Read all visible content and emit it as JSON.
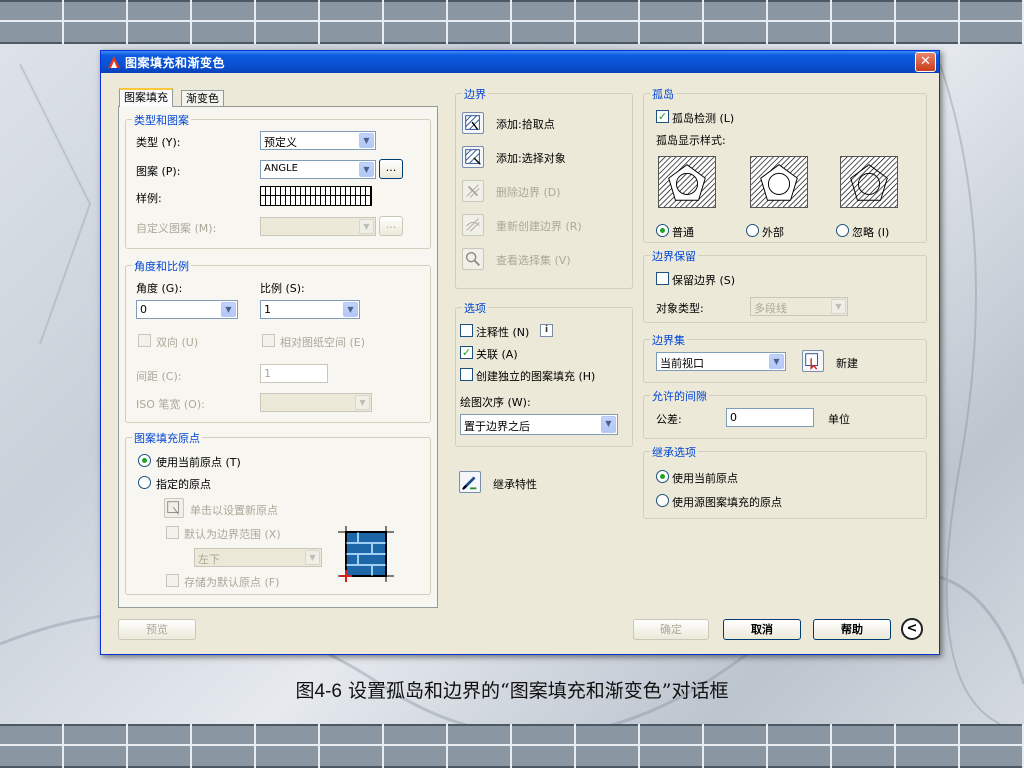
{
  "dialog": {
    "title": "图案填充和渐变色",
    "close_glyph": "✕",
    "tabs": [
      "图案填充",
      "渐变色"
    ]
  },
  "type_group": {
    "title": "类型和图案",
    "type_label": "类型 (Y):",
    "type_value": "预定义",
    "pattern_label": "图案 (P):",
    "pattern_value": "ANGLE",
    "browse_glyph": "...",
    "sample_label": "样例:",
    "custom_label": "自定义图案 (M):"
  },
  "angle_group": {
    "title": "角度和比例",
    "angle_label": "角度 (G):",
    "angle_value": "0",
    "scale_label": "比例 (S):",
    "scale_value": "1",
    "double_label": "双向 (U)",
    "relative_label": "相对图纸空间 (E)",
    "spacing_label": "间距 (C):",
    "spacing_value": "1",
    "iso_label": "ISO 笔宽 (O):"
  },
  "origin_group": {
    "title": "图案填充原点",
    "use_current": "使用当前原点 (T)",
    "specified": "指定的原点",
    "click_set": "单击以设置新原点",
    "default_extent": "默认为边界范围 (X)",
    "position_value": "左下",
    "store_default": "存储为默认原点 (F)"
  },
  "boundary_group": {
    "title": "边界",
    "add_pick": "添加:拾取点",
    "add_select": "添加:选择对象",
    "remove": "删除边界 (D)",
    "recreate": "重新创建边界 (R)",
    "view": "查看选择集 (V)"
  },
  "options_group": {
    "title": "选项",
    "annotative": "注释性 (N)",
    "info_glyph": "i",
    "associative": "关联 (A)",
    "separate": "创建独立的图案填充 (H)",
    "draw_order_label": "绘图次序 (W):",
    "draw_order_value": "置于边界之后"
  },
  "inherit": {
    "label": "继承特性"
  },
  "islands_group": {
    "title": "孤岛",
    "detect": "孤岛检测 (L)",
    "style_label": "孤岛显示样式:",
    "normal": "普通",
    "outer": "外部",
    "ignore": "忽略 (I)"
  },
  "retain_group": {
    "title": "边界保留",
    "retain": "保留边界 (S)",
    "object_type_label": "对象类型:",
    "object_type_value": "多段线"
  },
  "boundary_set_group": {
    "title": "边界集",
    "value": "当前视口",
    "new_label": "新建"
  },
  "gap_group": {
    "title": "允许的间隙",
    "tolerance_label": "公差:",
    "tolerance_value": "0",
    "unit_label": "单位"
  },
  "inherit_options_group": {
    "title": "继承选项",
    "use_current": "使用当前原点",
    "use_source": "使用源图案填充的原点"
  },
  "footer": {
    "preview": "预览",
    "ok": "确定",
    "cancel": "取消",
    "help": "帮助",
    "collapse_glyph": "<"
  },
  "caption": {
    "number": "图4-6",
    "text": "设置孤岛和边界的“图案填充和渐变色”对话框"
  },
  "colors": {
    "title_blue": "#0a4fd0",
    "group_title": "#0046d5",
    "check_green": "#21a121",
    "close_red": "#c93c1a"
  }
}
